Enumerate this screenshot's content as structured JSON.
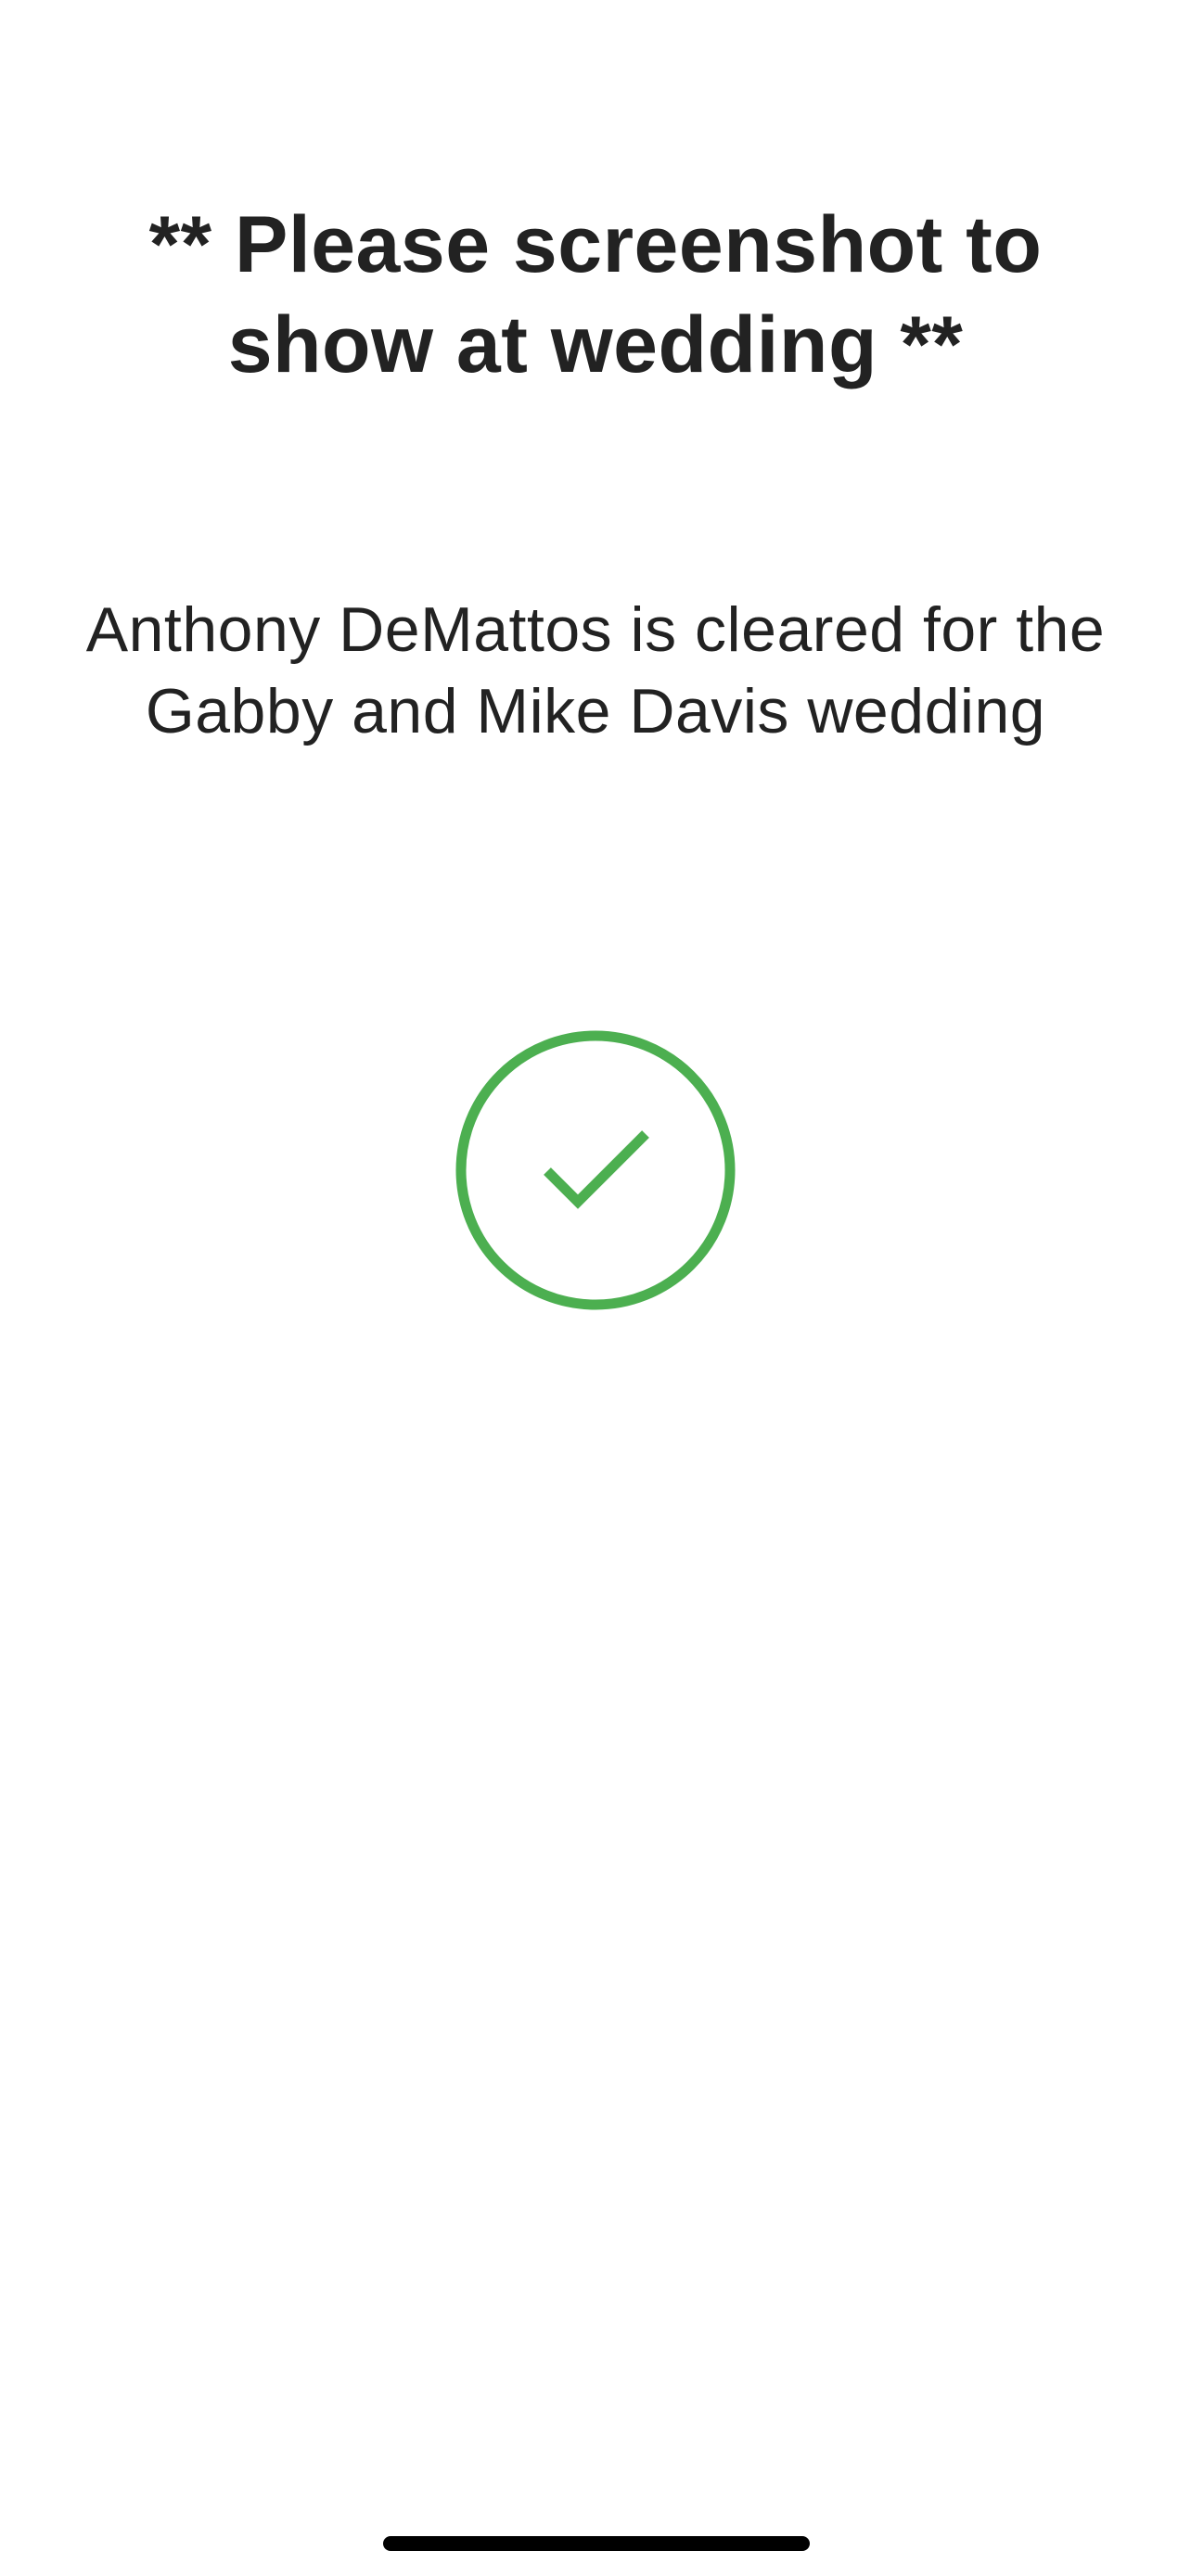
{
  "header": {
    "title": "** Please screenshot to show at wedding **"
  },
  "main": {
    "message": "Anthony DeMattos is cleared for the Gabby and Mike Davis wedding"
  },
  "status": {
    "icon": "checkmark-circle-icon",
    "color": "#4CAF50"
  },
  "colors": {
    "text": "#222222",
    "background": "#FFFFFF",
    "home_indicator": "#000000"
  }
}
